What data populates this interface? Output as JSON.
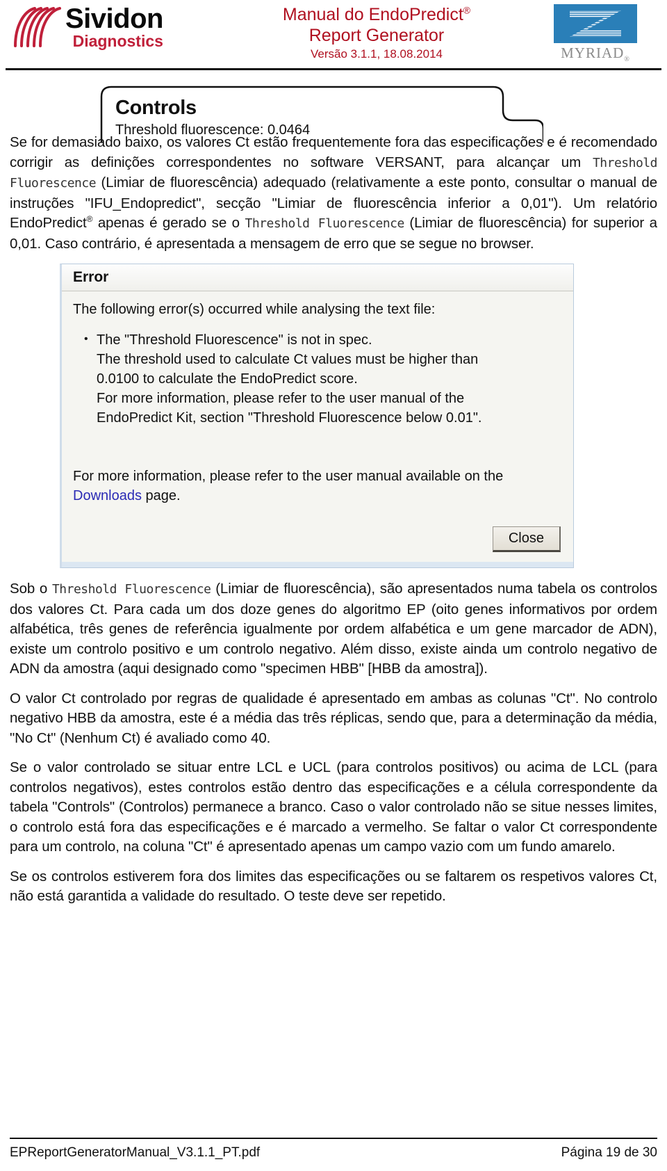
{
  "header": {
    "brand_name": "Sividon",
    "brand_sub": "Diagnostics",
    "brand_color": "#c0203a",
    "title": "Manual do EndoPredict",
    "title_reg": "®",
    "subtitle": "Report Generator",
    "version": "Versão 3.1.1, 18.08.2014",
    "title_color": "#b01020",
    "partner_name": "MYRIAD",
    "partner_reg": "®",
    "partner_box_color": "#2a7fb8"
  },
  "controls_screenshot": {
    "title": "Controls",
    "threshold_line": "Threshold fluorescence: 0.0464"
  },
  "paragraphs": {
    "p1_a": "Se for demasiado baixo, os valores Ct estão frequentemente fora das especificações e é recomendado corrigir as definições correspondentes no software VERSANT, para alcançar um ",
    "p1_term1": "Threshold Fluorescence",
    "p1_b": " (Limiar de fluorescência) adequado (relativamente a este ponto, consultar o manual de instruções \"IFU_Endopredict\", secção \"Limiar de fluorescência inferior a 0,01\"). Um relatório EndoPredict",
    "p1_reg": "®",
    "p1_c": " apenas é gerado se o ",
    "p1_term2": "Threshold Fluorescence",
    "p1_d": " (Limiar de fluorescência) for superior a 0,01. Caso contrário, é apresentada a mensagem de erro que se segue no browser.",
    "p2_a": "Sob o ",
    "p2_term": "Threshold Fluorescence",
    "p2_b": " (Limiar de fluorescência), são apresentados numa tabela os controlos dos valores Ct. Para cada um dos doze genes do algoritmo EP (oito genes informativos por ordem alfabética, três genes de referência igualmente por ordem alfabética e um gene marcador de ADN), existe um controlo positivo e um controlo negativo. Além disso, existe ainda um controlo negativo de ADN da amostra (aqui designado como \"specimen HBB\" [HBB da amostra]).",
    "p3": "O valor Ct controlado por regras de qualidade é apresentado em ambas as colunas \"Ct\". No controlo negativo HBB da amostra, este é a média das três réplicas, sendo que, para a determinação da média, \"No Ct\" (Nenhum Ct) é avaliado como 40.",
    "p4": "Se o valor controlado se situar entre LCL e UCL (para controlos positivos) ou acima de LCL (para controlos negativos), estes controlos estão dentro das especificações e a célula correspondente da tabela \"Controls\" (Controlos) permanece a branco. Caso o valor controlado não se situe nesses limites, o controlo está fora das especificações e é marcado a vermelho. Se faltar o valor Ct correspondente para um controlo, na coluna \"Ct\" é apresentado apenas um campo vazio com um fundo amarelo.",
    "p5": "Se os controlos estiverem fora dos limites das especificações ou se faltarem os respetivos valores Ct, não está garantida a validade do resultado. O teste deve ser repetido."
  },
  "error_dialog": {
    "title": "Error",
    "lead": "The following error(s) occurred while analysing the text file:",
    "bullets": [
      {
        "lines": [
          "The \"Threshold Fluorescence\" is not in spec.",
          "The threshold used to calculate Ct values must be higher than",
          "0.0100 to calculate the EndoPredict score.",
          "For more information, please refer to the user manual of the",
          "EndoPredict Kit, section \"Threshold Fluorescence below 0.01\"."
        ]
      }
    ],
    "footer_note_a": "For more information, please refer to the user manual available on the ",
    "footer_link": "Downloads",
    "footer_note_b": " page.",
    "close_label": "Close",
    "link_color": "#2a2ab5"
  },
  "footer": {
    "file_name": "EPReportGeneratorManual_V3.1.1_PT.pdf",
    "page_label": "Página 19 de 30"
  }
}
